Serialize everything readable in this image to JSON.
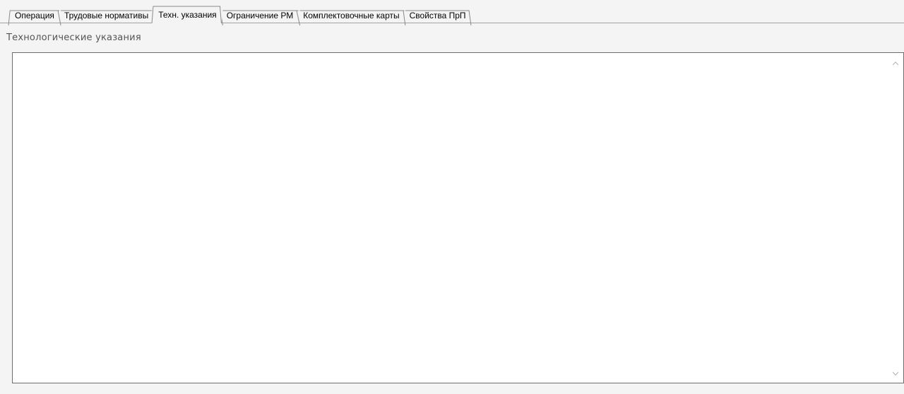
{
  "tabs": [
    {
      "label": "Операция",
      "active": false
    },
    {
      "label": "Трудовые нормативы",
      "active": false
    },
    {
      "label": "Техн. указания",
      "active": true
    },
    {
      "label": "Ограничение РМ",
      "active": false
    },
    {
      "label": "Комплектовочные карты",
      "active": false
    },
    {
      "label": "Свойства ПрП",
      "active": false
    }
  ],
  "section": {
    "title": "Технологические указания"
  },
  "editor": {
    "value": ""
  },
  "scrollbar": {
    "up_icon": "chevron-up-icon",
    "down_icon": "chevron-down-icon"
  },
  "colors": {
    "background": "#f4f4f4",
    "border": "#6d6d6d",
    "title": "#555555",
    "arrow": "#b8b8b8"
  }
}
